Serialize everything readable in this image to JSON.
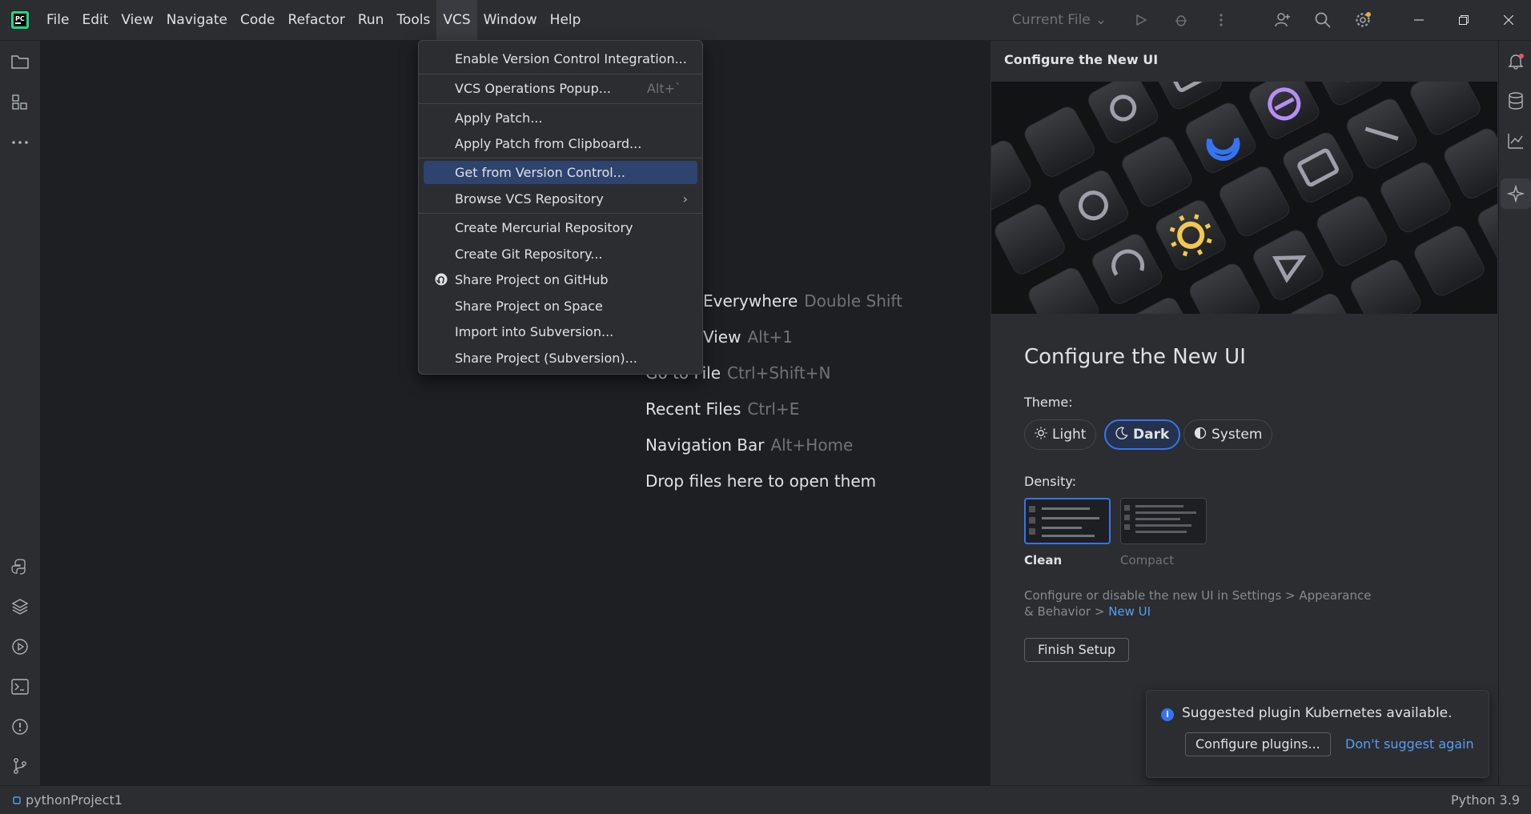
{
  "menubar": {
    "items": [
      "File",
      "Edit",
      "View",
      "Navigate",
      "Code",
      "Refactor",
      "Run",
      "Tools",
      "VCS",
      "Window",
      "Help"
    ],
    "active": "VCS",
    "run_config": "Current File"
  },
  "vcs_menu": {
    "items": [
      {
        "label": "Enable Version Control Integration...",
        "shortcut": ""
      },
      {
        "label": "VCS Operations Popup...",
        "shortcut": "Alt+`"
      },
      {
        "label": "Apply Patch...",
        "shortcut": ""
      },
      {
        "label": "Apply Patch from Clipboard...",
        "shortcut": ""
      },
      {
        "label": "Get from Version Control...",
        "shortcut": ""
      },
      {
        "label": "Browse VCS Repository",
        "shortcut": ""
      },
      {
        "label": "Create Mercurial Repository",
        "shortcut": ""
      },
      {
        "label": "Create Git Repository...",
        "shortcut": ""
      },
      {
        "label": "Share Project on GitHub",
        "shortcut": ""
      },
      {
        "label": "Share Project on Space",
        "shortcut": ""
      },
      {
        "label": "Import into Subversion...",
        "shortcut": ""
      },
      {
        "label": "Share Project (Subversion)...",
        "shortcut": ""
      }
    ],
    "highlighted": "Get from Version Control..."
  },
  "editor_tips": [
    {
      "label": "Everywhere",
      "shortcut": "Double Shift"
    },
    {
      "label": "View",
      "shortcut": "Alt+1"
    },
    {
      "label": "Go to File",
      "shortcut": "Ctrl+Shift+N"
    },
    {
      "label": "Recent Files",
      "shortcut": "Ctrl+E"
    },
    {
      "label": "Navigation Bar",
      "shortcut": "Alt+Home"
    },
    {
      "label": "Drop files here to open them",
      "shortcut": ""
    }
  ],
  "configure_panel": {
    "tab_title": "Configure the New UI",
    "heading": "Configure the New UI",
    "theme_label": "Theme:",
    "themes": [
      "Light",
      "Dark",
      "System"
    ],
    "selected_theme": "Dark",
    "density_label": "Density:",
    "densities": [
      "Clean",
      "Compact"
    ],
    "selected_density": "Clean",
    "note_text": "Configure or disable the new UI in Settings > Appearance & Behavior > ",
    "note_link": "New UI",
    "finish_button": "Finish Setup"
  },
  "notification": {
    "message": "Suggested plugin Kubernetes available.",
    "configure_button": "Configure plugins...",
    "dismiss_link": "Don't suggest again"
  },
  "statusbar": {
    "project": "pythonProject1",
    "interpreter": "Python 3.9"
  }
}
